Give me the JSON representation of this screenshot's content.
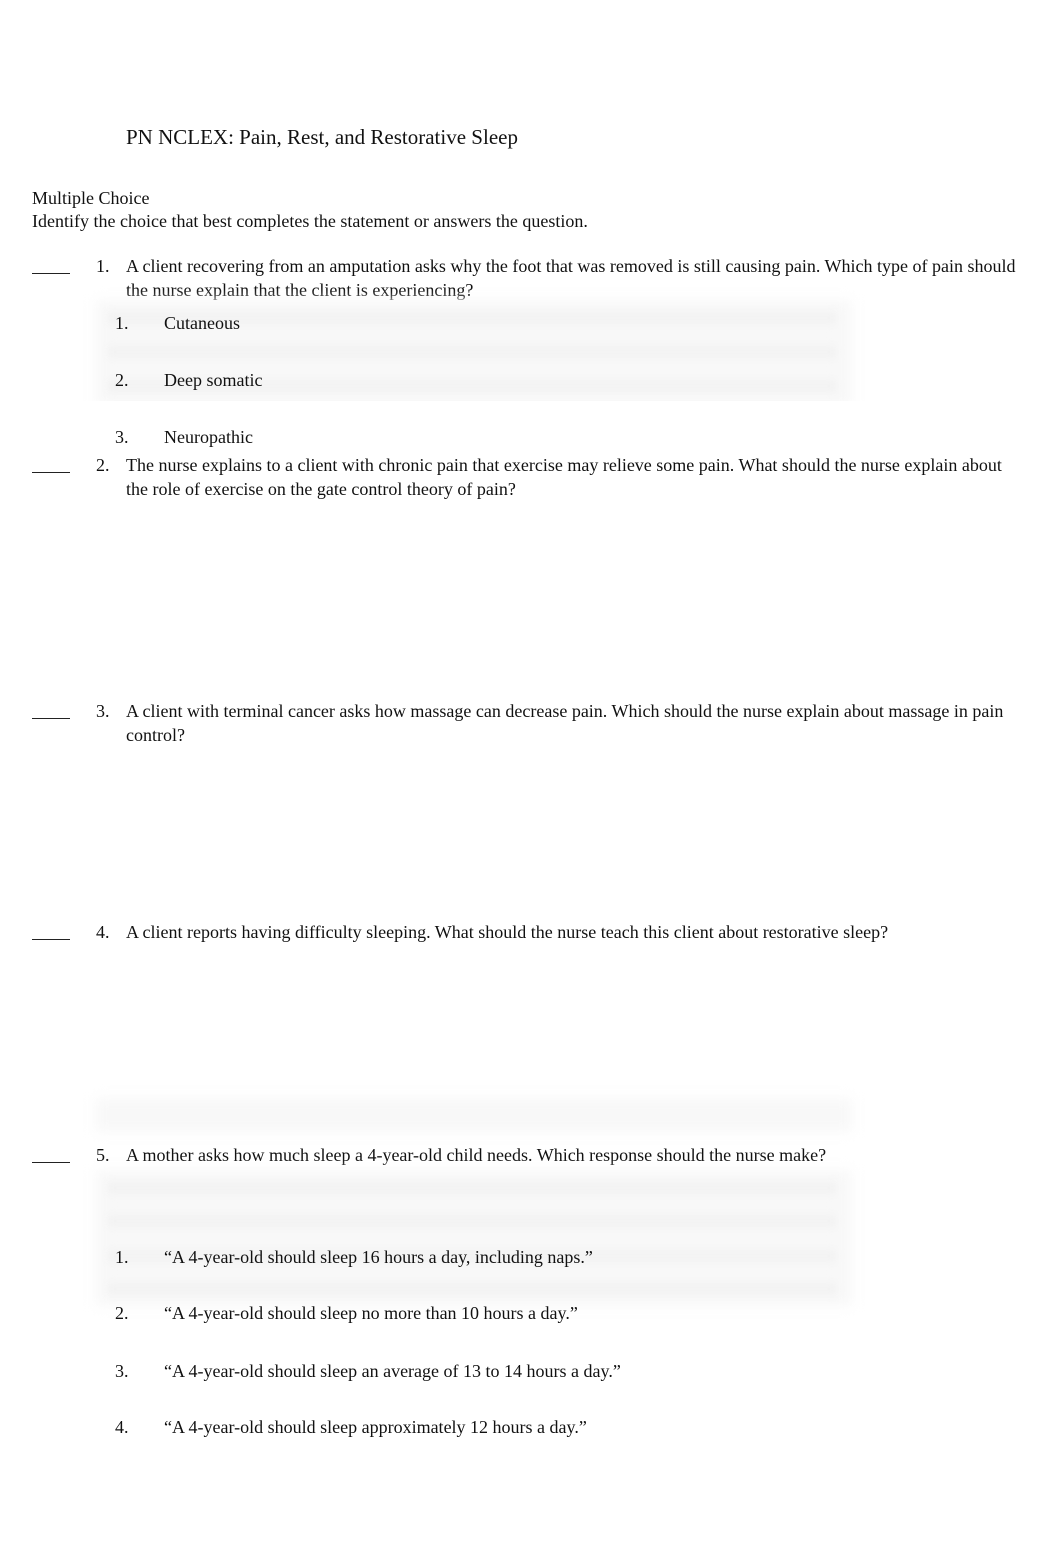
{
  "document": {
    "title": "PN NCLEX: Pain, Rest, and Restorative Sleep",
    "section_heading": "Multiple Choice",
    "instructions": "Identify the choice that best completes the statement or answers the question.",
    "answer_blank": "____",
    "questions": [
      {
        "number": "1.",
        "text": "A client recovering from an amputation asks why the foot that was removed is still causing pain. Which type of pain should the nurse explain that the client is experiencing?",
        "options": [
          {
            "number": "1.",
            "text": "Cutaneous"
          },
          {
            "number": "2.",
            "text": "Deep somatic"
          },
          {
            "number": "3.",
            "text": "Neuropathic"
          }
        ]
      },
      {
        "number": "2.",
        "text": "The nurse explains to a client with chronic pain that exercise may relieve some pain. What should the nurse explain about the role of exercise on the gate control theory of pain?",
        "options": []
      },
      {
        "number": "3.",
        "text": "A client with terminal cancer asks how massage can decrease pain. Which should the nurse explain about massage in pain control?",
        "options": []
      },
      {
        "number": "4.",
        "text": "A client reports having difficulty sleeping. What should the nurse teach this client about restorative sleep?",
        "options": []
      },
      {
        "number": "5.",
        "text": "A mother asks how much sleep a 4-year-old child needs. Which response should the nurse make?",
        "options": [
          {
            "number": "1.",
            "text": "“A 4-year-old should sleep 16 hours a day, including naps.”"
          },
          {
            "number": "2.",
            "text": "“A 4-year-old should sleep no more than 10 hours a day.”"
          },
          {
            "number": "3.",
            "text": "“A 4-year-old should sleep an average of 13 to 14 hours a day.”"
          },
          {
            "number": "4.",
            "text": "“A 4-year-old should sleep approximately 12 hours a day.”"
          }
        ]
      }
    ]
  }
}
